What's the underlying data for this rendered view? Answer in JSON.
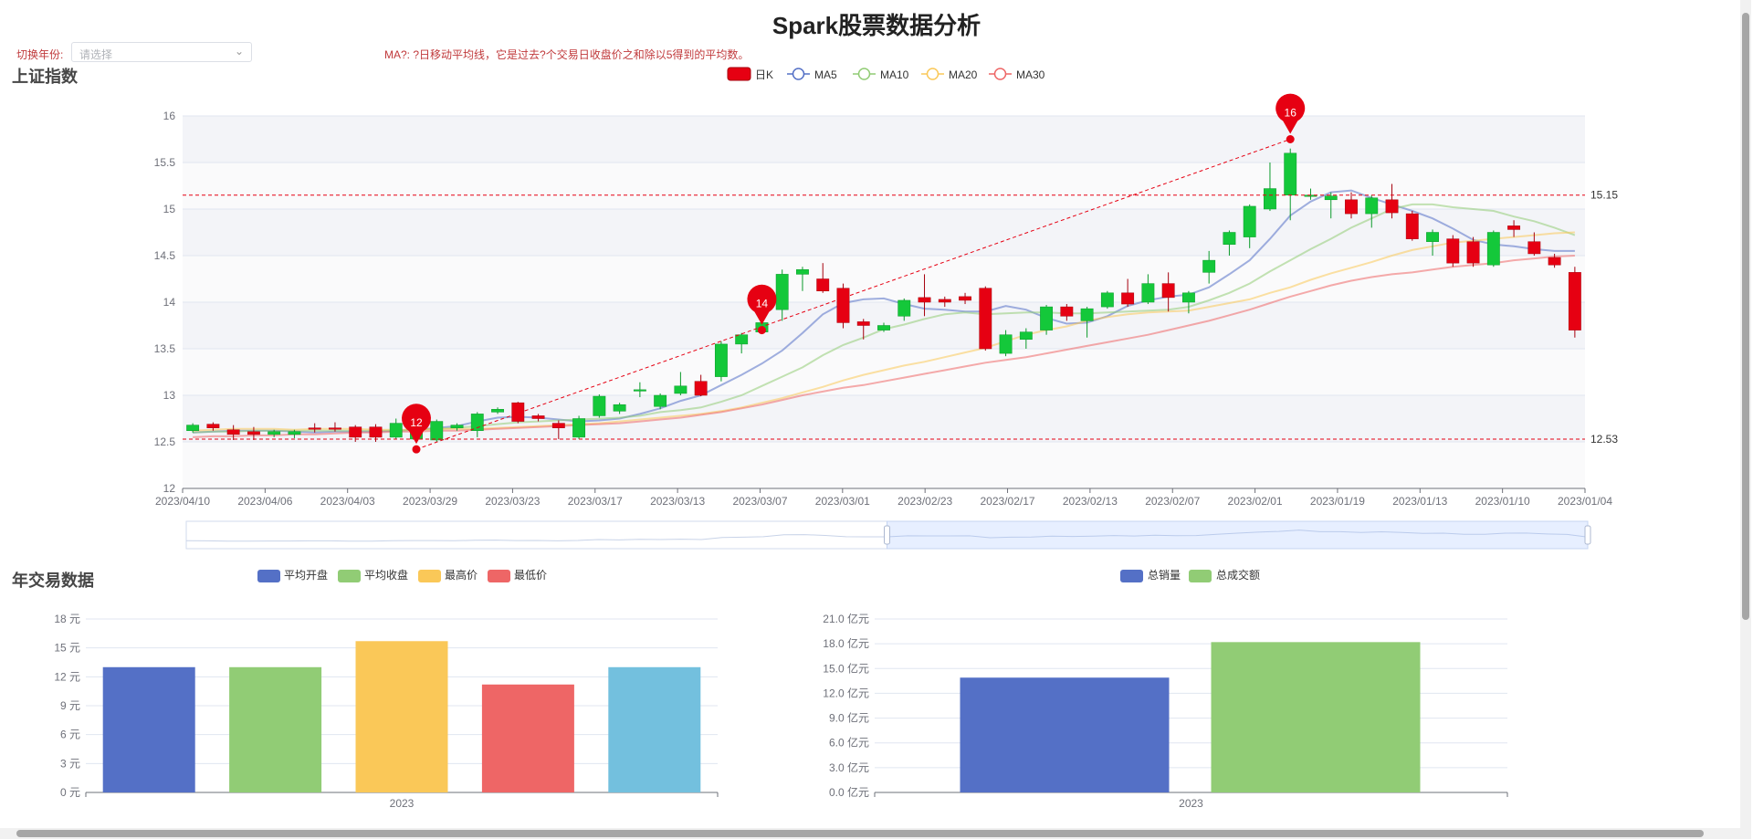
{
  "page": {
    "title": "Spark股票数据分析",
    "year_label": "切换年份:",
    "year_placeholder": "请选择",
    "ma_note": "MA?: ?日移动平均线，它是过去?个交易日收盘价之和除以5得到的平均数。",
    "kline_title": "上证指数",
    "annual_title": "年交易数据"
  },
  "colors": {
    "up": "#14c83a",
    "down": "#e60012",
    "ma5": "#5470c6",
    "ma10": "#91cc75",
    "ma20": "#fac858",
    "ma30": "#ee6666",
    "bar_blue": "#5470c6",
    "bar_green": "#91cc75",
    "bar_yellow": "#fac858",
    "bar_red": "#ee6666",
    "bar_cyan": "#73c0de",
    "markline": "#e60012"
  },
  "chart_data": [
    {
      "type": "candlestick",
      "title": "上证指数",
      "legend": [
        "日K",
        "MA5",
        "MA10",
        "MA20",
        "MA30"
      ],
      "ylim": [
        12,
        16
      ],
      "yticks": [
        "12",
        "12.5",
        "13",
        "13.5",
        "14",
        "14.5",
        "15",
        "15.5",
        "16"
      ],
      "x_tick_labels": [
        "2023/04/10",
        "2023/04/06",
        "2023/04/03",
        "2023/03/29",
        "2023/03/23",
        "2023/03/17",
        "2023/03/13",
        "2023/03/07",
        "2023/03/01",
        "2023/02/23",
        "2023/02/17",
        "2023/02/13",
        "2023/02/07",
        "2023/02/01",
        "2023/01/19",
        "2023/01/13",
        "2023/01/10",
        "2023/01/04"
      ],
      "candles": [
        [
          12.62,
          12.68,
          12.6,
          12.7
        ],
        [
          12.69,
          12.65,
          12.62,
          12.71
        ],
        [
          12.63,
          12.58,
          12.52,
          12.68
        ],
        [
          12.61,
          12.58,
          12.52,
          12.66
        ],
        [
          12.58,
          12.61,
          12.55,
          12.63
        ],
        [
          12.58,
          12.61,
          12.54,
          12.63
        ],
        [
          12.65,
          12.64,
          12.6,
          12.7
        ],
        [
          12.65,
          12.64,
          12.61,
          12.71
        ],
        [
          12.66,
          12.55,
          12.5,
          12.68
        ],
        [
          12.66,
          12.55,
          12.5,
          12.69
        ],
        [
          12.55,
          12.7,
          12.53,
          12.75
        ],
        [
          12.53,
          12.72,
          12.52,
          12.74
        ],
        [
          12.52,
          12.72,
          12.5,
          12.74
        ],
        [
          12.65,
          12.68,
          12.62,
          12.7
        ],
        [
          12.62,
          12.8,
          12.55,
          12.82
        ],
        [
          12.82,
          12.85,
          12.8,
          12.87
        ],
        [
          12.92,
          12.72,
          12.7,
          12.93
        ],
        [
          12.78,
          12.75,
          12.72,
          12.8
        ],
        [
          12.7,
          12.65,
          12.53,
          12.73
        ],
        [
          12.55,
          12.75,
          12.53,
          12.78
        ],
        [
          12.78,
          12.99,
          12.76,
          13.01
        ],
        [
          12.83,
          12.9,
          12.8,
          12.92
        ],
        [
          13.05,
          13.06,
          12.98,
          13.14
        ],
        [
          12.88,
          13.0,
          12.85,
          13.02
        ],
        [
          13.02,
          13.1,
          13.0,
          13.25
        ],
        [
          13.15,
          13.0,
          12.99,
          13.22
        ],
        [
          13.2,
          13.55,
          13.15,
          13.58
        ],
        [
          13.55,
          13.65,
          13.45,
          13.67
        ],
        [
          13.68,
          13.78,
          13.66,
          13.81
        ],
        [
          13.92,
          14.3,
          13.8,
          14.35
        ],
        [
          14.3,
          14.35,
          14.12,
          14.38
        ],
        [
          14.25,
          14.12,
          14.1,
          14.42
        ],
        [
          14.15,
          13.78,
          13.72,
          14.2
        ],
        [
          13.79,
          13.75,
          13.6,
          13.82
        ],
        [
          13.7,
          13.75,
          13.68,
          13.78
        ],
        [
          13.85,
          14.02,
          13.8,
          14.04
        ],
        [
          14.05,
          14.0,
          13.85,
          14.3
        ],
        [
          14.03,
          14.0,
          13.95,
          14.06
        ],
        [
          14.06,
          14.02,
          13.98,
          14.1
        ],
        [
          14.15,
          13.5,
          13.48,
          14.17
        ],
        [
          13.45,
          13.65,
          13.42,
          13.7
        ],
        [
          13.6,
          13.68,
          13.5,
          13.72
        ],
        [
          13.7,
          13.95,
          13.65,
          13.97
        ],
        [
          13.95,
          13.85,
          13.8,
          13.98
        ],
        [
          13.8,
          13.93,
          13.62,
          13.95
        ],
        [
          13.95,
          14.1,
          13.93,
          14.12
        ],
        [
          14.1,
          13.98,
          13.95,
          14.25
        ],
        [
          14.0,
          14.2,
          13.98,
          14.3
        ],
        [
          14.2,
          14.05,
          13.9,
          14.32
        ],
        [
          14.0,
          14.1,
          13.88,
          14.12
        ],
        [
          14.32,
          14.45,
          14.2,
          14.55
        ],
        [
          14.62,
          14.75,
          14.5,
          14.77
        ],
        [
          14.7,
          15.03,
          14.58,
          15.05
        ],
        [
          15.0,
          15.22,
          14.98,
          15.5
        ],
        [
          15.15,
          15.6,
          14.88,
          15.65
        ],
        [
          15.15,
          15.15,
          15.1,
          15.22
        ],
        [
          15.1,
          15.14,
          14.9,
          15.18
        ],
        [
          15.1,
          14.95,
          14.9,
          15.18
        ],
        [
          14.95,
          15.12,
          14.8,
          15.15
        ],
        [
          15.1,
          14.96,
          14.9,
          15.27
        ],
        [
          14.95,
          14.68,
          14.66,
          14.98
        ],
        [
          14.65,
          14.75,
          14.5,
          14.78
        ],
        [
          14.68,
          14.42,
          14.38,
          14.72
        ],
        [
          14.65,
          14.42,
          14.38,
          14.7
        ],
        [
          14.4,
          14.75,
          14.38,
          14.77
        ],
        [
          14.82,
          14.78,
          14.7,
          14.88
        ],
        [
          14.65,
          14.52,
          14.5,
          14.75
        ],
        [
          14.48,
          14.4,
          14.37,
          14.52
        ],
        [
          14.32,
          13.7,
          13.62,
          14.38
        ]
      ],
      "ma5": [
        12.6,
        12.61,
        12.62,
        12.62,
        12.62,
        12.61,
        12.6,
        12.61,
        12.61,
        12.61,
        12.62,
        12.63,
        12.65,
        12.67,
        12.72,
        12.76,
        12.77,
        12.76,
        12.74,
        12.72,
        12.73,
        12.75,
        12.8,
        12.86,
        12.94,
        13.0,
        13.11,
        13.22,
        13.34,
        13.48,
        13.67,
        13.87,
        13.99,
        14.03,
        14.04,
        13.98,
        13.93,
        13.92,
        13.9,
        13.9,
        13.96,
        13.92,
        13.83,
        13.77,
        13.78,
        13.85,
        13.96,
        14.02,
        14.06,
        14.08,
        14.16,
        14.3,
        14.45,
        14.68,
        14.93,
        15.08,
        15.18,
        15.2,
        15.12,
        15.05,
        14.98,
        14.9,
        14.79,
        14.67,
        14.62,
        14.6,
        14.57,
        14.55,
        14.55
      ],
      "ma10": [
        12.6,
        12.61,
        12.61,
        12.62,
        12.62,
        12.62,
        12.62,
        12.62,
        12.62,
        12.62,
        12.62,
        12.63,
        12.64,
        12.65,
        12.67,
        12.69,
        12.71,
        12.72,
        12.73,
        12.74,
        12.75,
        12.76,
        12.78,
        12.82,
        12.84,
        12.87,
        12.93,
        13.0,
        13.1,
        13.2,
        13.3,
        13.43,
        13.54,
        13.62,
        13.71,
        13.76,
        13.82,
        13.87,
        13.89,
        13.87,
        13.88,
        13.89,
        13.89,
        13.88,
        13.88,
        13.89,
        13.9,
        13.91,
        13.92,
        13.95,
        14.02,
        14.1,
        14.2,
        14.33,
        14.45,
        14.57,
        14.68,
        14.8,
        14.9,
        15.0,
        15.05,
        15.05,
        15.02,
        15.0,
        14.98,
        14.92,
        14.87,
        14.8,
        14.72
      ],
      "ma20": [
        12.62,
        12.63,
        12.64,
        12.64,
        12.64,
        12.63,
        12.64,
        12.64,
        12.64,
        12.63,
        12.63,
        12.63,
        12.64,
        12.64,
        12.64,
        12.65,
        12.66,
        12.67,
        12.68,
        12.69,
        12.7,
        12.72,
        12.74,
        12.76,
        12.78,
        12.8,
        12.83,
        12.87,
        12.92,
        12.97,
        13.03,
        13.09,
        13.16,
        13.22,
        13.27,
        13.32,
        13.36,
        13.41,
        13.46,
        13.51,
        13.58,
        13.65,
        13.7,
        13.74,
        13.8,
        13.84,
        13.87,
        13.89,
        13.9,
        13.91,
        13.95,
        13.99,
        14.03,
        14.1,
        14.16,
        14.24,
        14.31,
        14.37,
        14.43,
        14.5,
        14.56,
        14.6,
        14.64,
        14.66,
        14.68,
        14.7,
        14.72,
        14.74,
        14.75
      ],
      "ma30": [
        12.55,
        12.56,
        12.56,
        12.57,
        12.57,
        12.58,
        12.58,
        12.59,
        12.6,
        12.6,
        12.61,
        12.61,
        12.62,
        12.62,
        12.63,
        12.64,
        12.65,
        12.66,
        12.67,
        12.68,
        12.69,
        12.7,
        12.72,
        12.74,
        12.76,
        12.79,
        12.82,
        12.86,
        12.9,
        12.95,
        13.0,
        13.04,
        13.08,
        13.11,
        13.15,
        13.19,
        13.23,
        13.27,
        13.31,
        13.35,
        13.38,
        13.41,
        13.45,
        13.49,
        13.53,
        13.57,
        13.61,
        13.65,
        13.7,
        13.75,
        13.8,
        13.86,
        13.92,
        13.99,
        14.06,
        14.12,
        14.18,
        14.23,
        14.27,
        14.3,
        14.32,
        14.35,
        14.38,
        14.4,
        14.42,
        14.45,
        14.47,
        14.49,
        14.5
      ],
      "mark_points": [
        {
          "label": "12",
          "index": 11,
          "value": 12.42
        },
        {
          "label": "14",
          "index": 28,
          "value": 13.7
        },
        {
          "label": "16",
          "index": 54,
          "value": 15.75
        }
      ],
      "mark_lines": [
        {
          "label": "15.15",
          "value": 15.15
        },
        {
          "label": "12.53",
          "value": 12.53
        }
      ],
      "datazoom_range": [
        50,
        100
      ]
    },
    {
      "type": "bar",
      "legend": [
        "平均开盘",
        "平均收盘",
        "最高价",
        "最低价"
      ],
      "categories": [
        "2023"
      ],
      "yticks": [
        "0 元",
        "3 元",
        "6 元",
        "9 元",
        "12 元",
        "15 元",
        "18 元"
      ],
      "ylim": [
        0,
        18
      ],
      "values": [
        13.0,
        13.0,
        15.7,
        11.2,
        13.0
      ]
    },
    {
      "type": "bar",
      "legend": [
        "总销量",
        "总成交额"
      ],
      "categories": [
        "2023"
      ],
      "yticks": [
        "0.0 亿元",
        "3.0 亿元",
        "6.0 亿元",
        "9.0 亿元",
        "12.0 亿元",
        "15.0 亿元",
        "18.0 亿元",
        "21.0 亿元"
      ],
      "ylim": [
        0,
        21
      ],
      "values": [
        13.9,
        18.2
      ]
    }
  ]
}
